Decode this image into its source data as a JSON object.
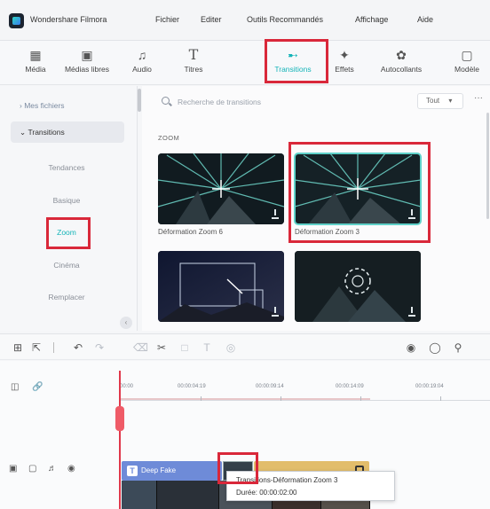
{
  "app": {
    "name": "Wondershare Filmora",
    "menu": [
      "Fichier",
      "Editer",
      "Outils Recommandés",
      "Affichage",
      "Aide"
    ]
  },
  "toolbar": {
    "tabs": [
      {
        "label": "Média",
        "icon": "media-icon"
      },
      {
        "label": "Médias libres",
        "icon": "stock-media-icon"
      },
      {
        "label": "Audio",
        "icon": "music-note-icon"
      },
      {
        "label": "Titres",
        "icon": "text-T-icon"
      },
      {
        "label": "Transitions",
        "icon": "transition-arrow-icon",
        "active": true
      },
      {
        "label": "Effets",
        "icon": "sparkle-icon"
      },
      {
        "label": "Autocollants",
        "icon": "sticker-icon"
      },
      {
        "label": "Modèle",
        "icon": "template-icon"
      }
    ]
  },
  "sidebar": {
    "my_files": "Mes fichiers",
    "transitions": "Transitions",
    "sub_items": [
      "Tendances",
      "Basique",
      "Zoom",
      "Cinéma",
      "Remplacer"
    ],
    "active_sub": "Zoom"
  },
  "content": {
    "search_placeholder": "Recherche de transitions",
    "filter_value": "Tout",
    "more": "···",
    "section": "ZOOM",
    "items": [
      {
        "label": "Déformation Zoom 6"
      },
      {
        "label": "Déformation Zoom 3",
        "selected": true
      },
      {
        "label": ""
      },
      {
        "label": ""
      }
    ]
  },
  "timeline": {
    "ticks": [
      "00:00",
      "00:00:04:19",
      "00:00:09:14",
      "00:00:14:09",
      "00:00:19:04"
    ],
    "clip_title": "Deep Fake",
    "tooltip_title": "Transitions-Déformation Zoom 3",
    "tooltip_duration": "Durée: 00:00:02:00"
  },
  "colors": {
    "accent": "#15b4b8",
    "highlight": "#d9283a",
    "playhead": "#e0374a",
    "title_clip": "#6e8bd8",
    "audio_clip": "#e2bd6b"
  }
}
